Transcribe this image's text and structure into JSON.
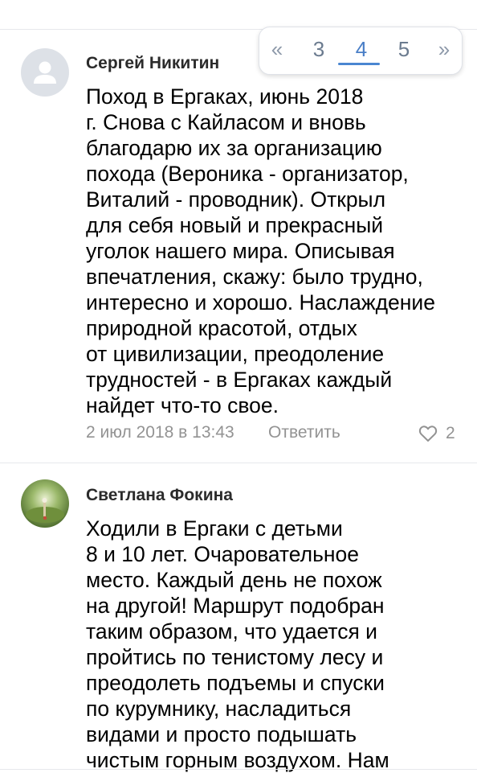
{
  "comments": [
    {
      "author": "Сергей Никитин",
      "lines": [
        "Поход в Ергаках, июнь 2018",
        "г. Снова с Кайласом и вновь",
        "благодарю их за организацию",
        "похода (Вероника - организатор,",
        "Виталий - проводник). Открыл",
        "для себя новый и прекрасный",
        "уголок нашего мира. Описывая",
        "впечатления, скажу: было трудно,",
        "интересно и хорошо. Наслаждение",
        "природной красотой, отдых",
        "от цивилизации, преодоление",
        "трудностей - в Ергаках каждый",
        "найдет что-то свое."
      ],
      "date": "2 июл 2018 в 13:43",
      "reply_label": "Ответить",
      "likes": "2"
    },
    {
      "author": "Светлана Фокина",
      "lines": [
        "Ходили в Ергаки с детьми",
        "8 и 10 лет. Очаровательное",
        "место. Каждый день не похож",
        "на другой! Маршрут подобран",
        "таким образом, что удается и",
        "пройтись по тенистому лесу и",
        "преодолеть подъемы и спуски",
        "по курумнику, насладиться",
        "видами и просто подышать",
        "чистым горным воздухом. Нам"
      ]
    }
  ],
  "pagination": {
    "prev_label": "«",
    "pages": [
      "3",
      "4",
      "5"
    ],
    "current_page": "4",
    "next_label": "»"
  },
  "icons": {
    "avatar_placeholder": "user-silhouette-icon",
    "like": "heart-outline-icon"
  },
  "colors": {
    "accent": "#4a86d1",
    "meta_text": "#939393",
    "divider": "#e7e8ec",
    "avatar_placeholder_bg": "#dde1e7"
  }
}
